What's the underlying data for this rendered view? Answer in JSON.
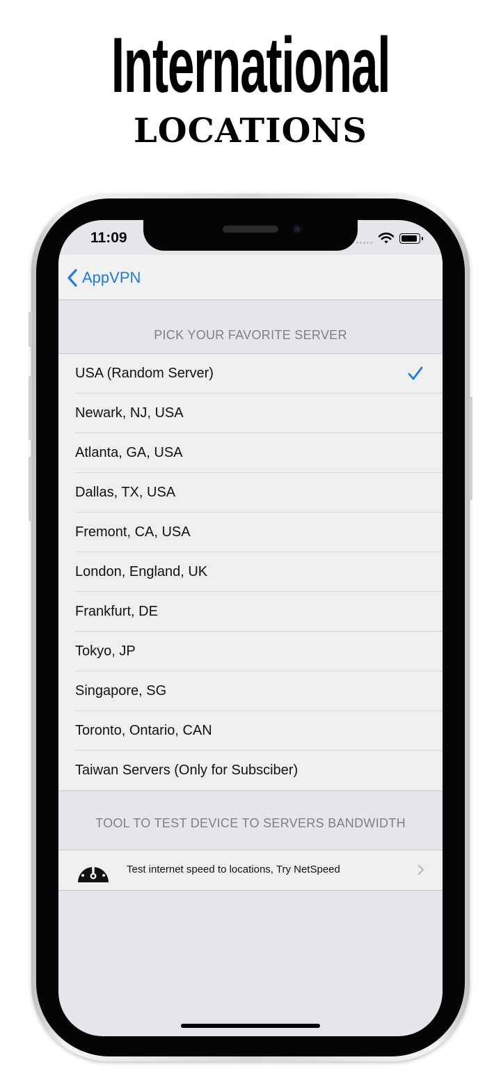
{
  "promo": {
    "headline": "International",
    "subhead": "LOCATIONS"
  },
  "status_bar": {
    "time": "11:09"
  },
  "nav": {
    "back_label": "AppVPN",
    "accent_color": "#1f7bd6"
  },
  "servers_section": {
    "header": "PICK YOUR FAVORITE SERVER",
    "selected_index": 0,
    "items": [
      {
        "label": "USA (Random Server)"
      },
      {
        "label": "Newark, NJ, USA"
      },
      {
        "label": "Atlanta, GA, USA"
      },
      {
        "label": "Dallas, TX, USA"
      },
      {
        "label": "Fremont, CA, USA"
      },
      {
        "label": "London, England, UK"
      },
      {
        "label": "Frankfurt, DE"
      },
      {
        "label": "Tokyo, JP"
      },
      {
        "label": "Singapore, SG"
      },
      {
        "label": "Toronto, Ontario, CAN"
      },
      {
        "label": "Taiwan Servers (Only for Subsciber)"
      }
    ]
  },
  "tool_section": {
    "header": "TOOL TO TEST DEVICE TO SERVERS BANDWIDTH",
    "item_label": "Test internet speed to locations, Try NetSpeed",
    "item_icon": "speedometer-icon"
  }
}
